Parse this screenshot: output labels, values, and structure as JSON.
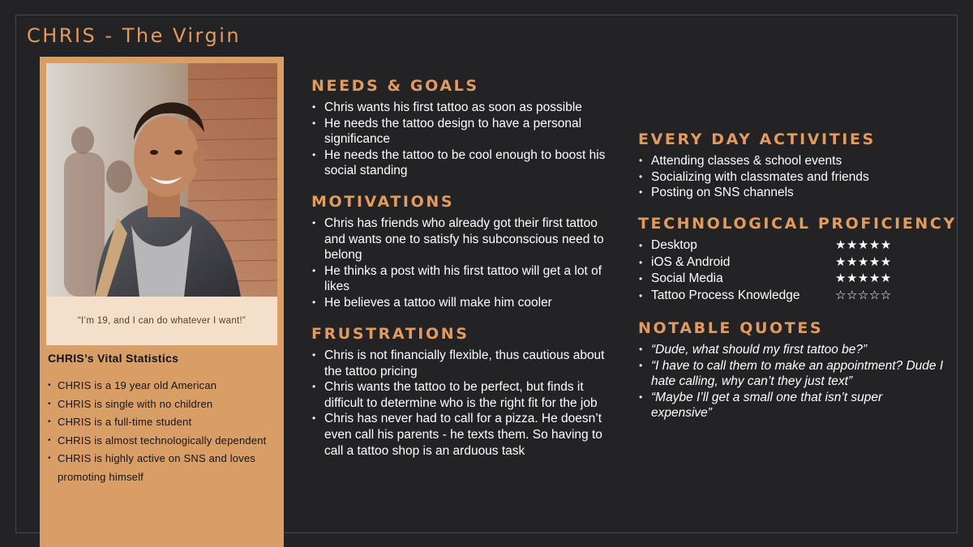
{
  "title": "CHRIS - The Virgin",
  "profile": {
    "quote": "“I’m 19, and I can do whatever I want!”",
    "vital_title": "CHRIS’s Vital Statistics",
    "vital_stats": [
      "CHRIS is a 19 year old American",
      "CHRIS is single with no children",
      "CHRIS is a full-time student",
      "CHRIS is almost technologically dependent",
      "CHRIS is highly active on SNS and loves promoting himself"
    ]
  },
  "needs_goals": {
    "heading": "NEEDS & GOALS",
    "items": [
      "Chris wants his first tattoo as soon as possible",
      "He needs the tattoo design to have a personal significance",
      "He needs the tattoo to be cool enough to boost his social standing"
    ]
  },
  "motivations": {
    "heading": "MOTIVATIONS",
    "items": [
      "Chris has friends who already got their first tattoo and wants one to satisfy his subconscious need to belong",
      "He thinks a post with his first tattoo will get a lot of likes",
      "He believes a tattoo will make him cooler"
    ]
  },
  "frustrations": {
    "heading": "FRUSTRATIONS",
    "items": [
      "Chris is not financially flexible, thus cautious about the tattoo pricing",
      "Chris wants the tattoo to be perfect, but finds it difficult to determine who is the right fit for the job",
      "Chris has never had to call for a pizza. He doesn’t even call his parents - he texts them. So having to call a tattoo shop is an arduous task"
    ]
  },
  "activities": {
    "heading": "EVERY DAY ACTIVITIES",
    "items": [
      "Attending classes & school events",
      "Socializing with classmates and friends",
      "Posting on SNS channels"
    ]
  },
  "proficiency": {
    "heading": "TECHNOLOGICAL PROFICIENCY",
    "rows": [
      {
        "name": "Desktop",
        "stars": "★★★★★"
      },
      {
        "name": "iOS & Android",
        "stars": "★★★★★"
      },
      {
        "name": "Social Media",
        "stars": "★★★★★"
      },
      {
        "name": "Tattoo Process Knowledge",
        "stars": "☆☆☆☆☆"
      }
    ]
  },
  "quotes": {
    "heading": "NOTABLE QUOTES",
    "items": [
      "“Dude, what should my first tattoo be?”",
      "“I have to call them to make an appointment? Dude I hate calling, why can’t they just text”",
      "“Maybe I’ll get a small one that isn’t super expensive”"
    ]
  },
  "colors": {
    "background": "#232325",
    "accent": "#e39a5d",
    "profile_panel": "#d99d66",
    "quote_panel": "#f4dfcb"
  }
}
